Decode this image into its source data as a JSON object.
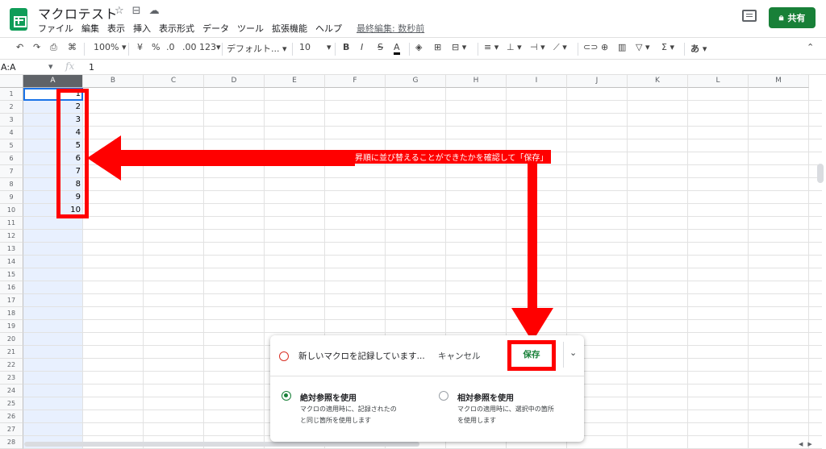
{
  "app": {
    "title": "マクロテスト",
    "menu": [
      "ファイル",
      "編集",
      "表示",
      "挿入",
      "表示形式",
      "データ",
      "ツール",
      "拡張機能",
      "ヘルプ"
    ],
    "last_edit": "最終編集: 数秒前",
    "share_label": "共有",
    "accent": "#188038"
  },
  "toolbar": {
    "zoom": "100%",
    "currency": "¥",
    "percent": "%",
    "dec_decrease": ".0",
    "dec_increase": ".00",
    "format_123": "123",
    "font": "デフォルト...",
    "font_size": "10",
    "bold": "B",
    "italic": "I",
    "strike": "S",
    "text_color": "A",
    "input_tools": "あ"
  },
  "formula_bar": {
    "name_box": "A:A",
    "fx": "fx",
    "value": "1"
  },
  "grid": {
    "columns": [
      "A",
      "B",
      "C",
      "D",
      "E",
      "F",
      "G",
      "H",
      "I",
      "J",
      "K",
      "L",
      "M"
    ],
    "selected_column": "A",
    "rows": [
      "1",
      "2",
      "3",
      "4",
      "5",
      "6",
      "7",
      "8",
      "9",
      "10",
      "11",
      "12",
      "13",
      "14",
      "15",
      "16",
      "17",
      "18",
      "19",
      "20",
      "21",
      "22",
      "23",
      "24",
      "25",
      "26",
      "27",
      "28"
    ],
    "colA_values": [
      "1",
      "2",
      "3",
      "4",
      "5",
      "6",
      "7",
      "8",
      "9",
      "10"
    ]
  },
  "annotation": {
    "callout": "昇順に並び替えることができたかを確認して「保存」",
    "color": "#ff0000"
  },
  "macro_panel": {
    "recording_text": "新しいマクロを記録しています...",
    "cancel_label": "キャンセル",
    "save_label": "保存",
    "absolute": {
      "title": "絶対参照を使用",
      "desc_line1": "マクロの適用時に、記録されたの",
      "desc_line2": "と同じ箇所を使用します"
    },
    "relative": {
      "title": "相対参照を使用",
      "desc_line1": "マクロの適用時に、選択中の箇所",
      "desc_line2": "を使用します"
    }
  }
}
